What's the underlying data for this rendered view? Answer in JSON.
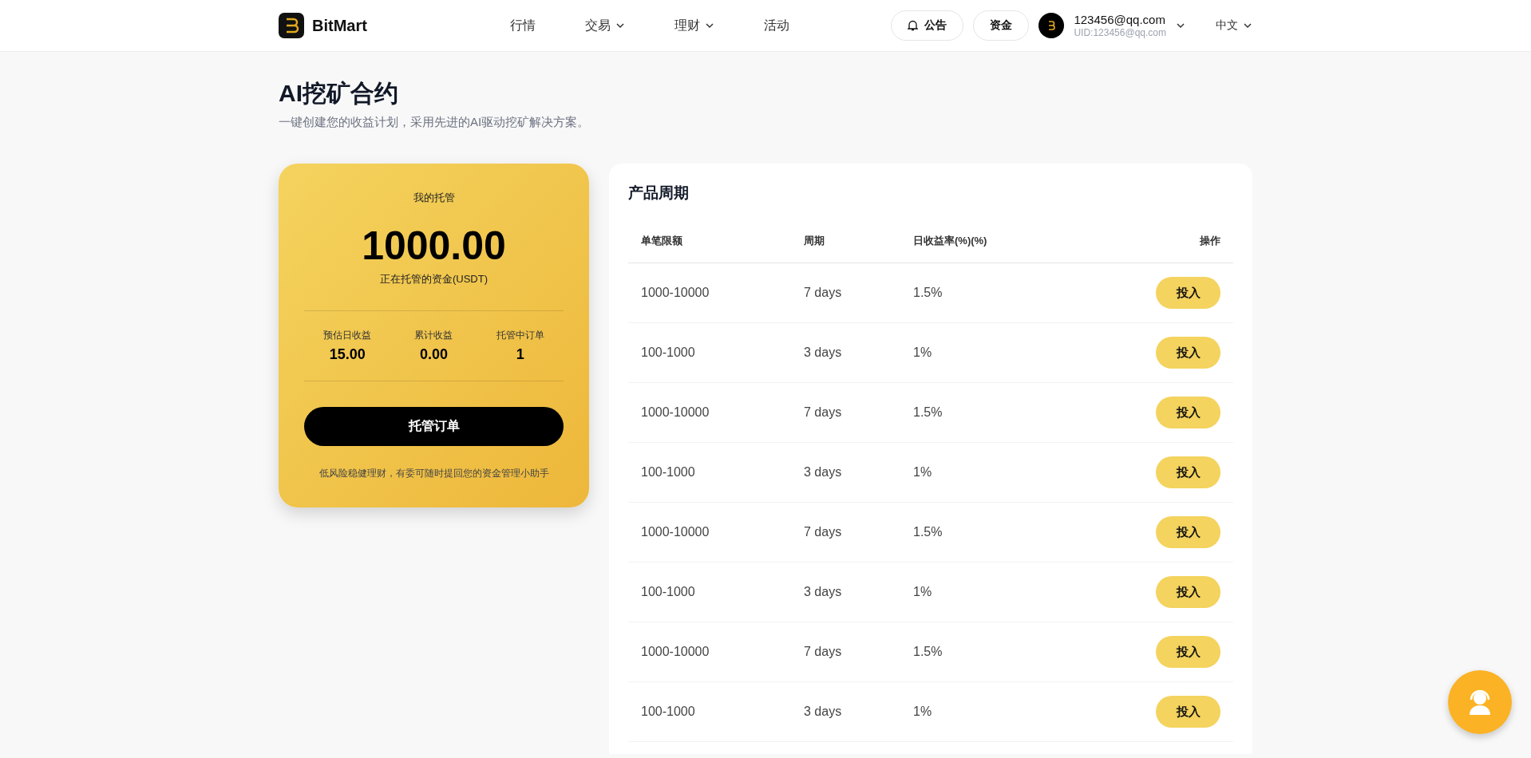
{
  "header": {
    "brand": "BitMart",
    "nav": [
      {
        "label": "行情",
        "dropdown": false
      },
      {
        "label": "交易",
        "dropdown": true
      },
      {
        "label": "理财",
        "dropdown": true
      },
      {
        "label": "活动",
        "dropdown": false
      }
    ],
    "notice_button": "公告",
    "funds_button": "资金",
    "user": {
      "email": "123456@qq.com",
      "uid": "UID:123456@qq.com"
    },
    "language": "中文"
  },
  "page": {
    "title": "AI挖矿合约",
    "subtitle": "一键创建您的收益计划，采用先进的AI驱动挖矿解决方案。"
  },
  "custody": {
    "title": "我的托管",
    "amount": "1000.00",
    "amount_label": "正在托管的资金(USDT)",
    "stats": [
      {
        "label": "预估日收益",
        "value": "15.00"
      },
      {
        "label": "累计收益",
        "value": "0.00"
      },
      {
        "label": "托管中订单",
        "value": "1"
      }
    ],
    "button": "托管订单",
    "note": "低风险稳健理财，有委可随时提回您的资金管理小助手"
  },
  "products": {
    "title": "产品周期",
    "columns": [
      "单笔限额",
      "周期",
      "日收益率(%)(%)",
      "操作"
    ],
    "rows": [
      {
        "limit": "1000-10000",
        "period": "7 days",
        "rate": "1.5%",
        "action": "投入"
      },
      {
        "limit": "100-1000",
        "period": "3 days",
        "rate": "1%",
        "action": "投入"
      },
      {
        "limit": "1000-10000",
        "period": "7 days",
        "rate": "1.5%",
        "action": "投入"
      },
      {
        "limit": "100-1000",
        "period": "3 days",
        "rate": "1%",
        "action": "投入"
      },
      {
        "limit": "1000-10000",
        "period": "7 days",
        "rate": "1.5%",
        "action": "投入"
      },
      {
        "limit": "100-1000",
        "period": "3 days",
        "rate": "1%",
        "action": "投入"
      },
      {
        "limit": "1000-10000",
        "period": "7 days",
        "rate": "1.5%",
        "action": "投入"
      },
      {
        "limit": "100-1000",
        "period": "3 days",
        "rate": "1%",
        "action": "投入"
      }
    ]
  }
}
